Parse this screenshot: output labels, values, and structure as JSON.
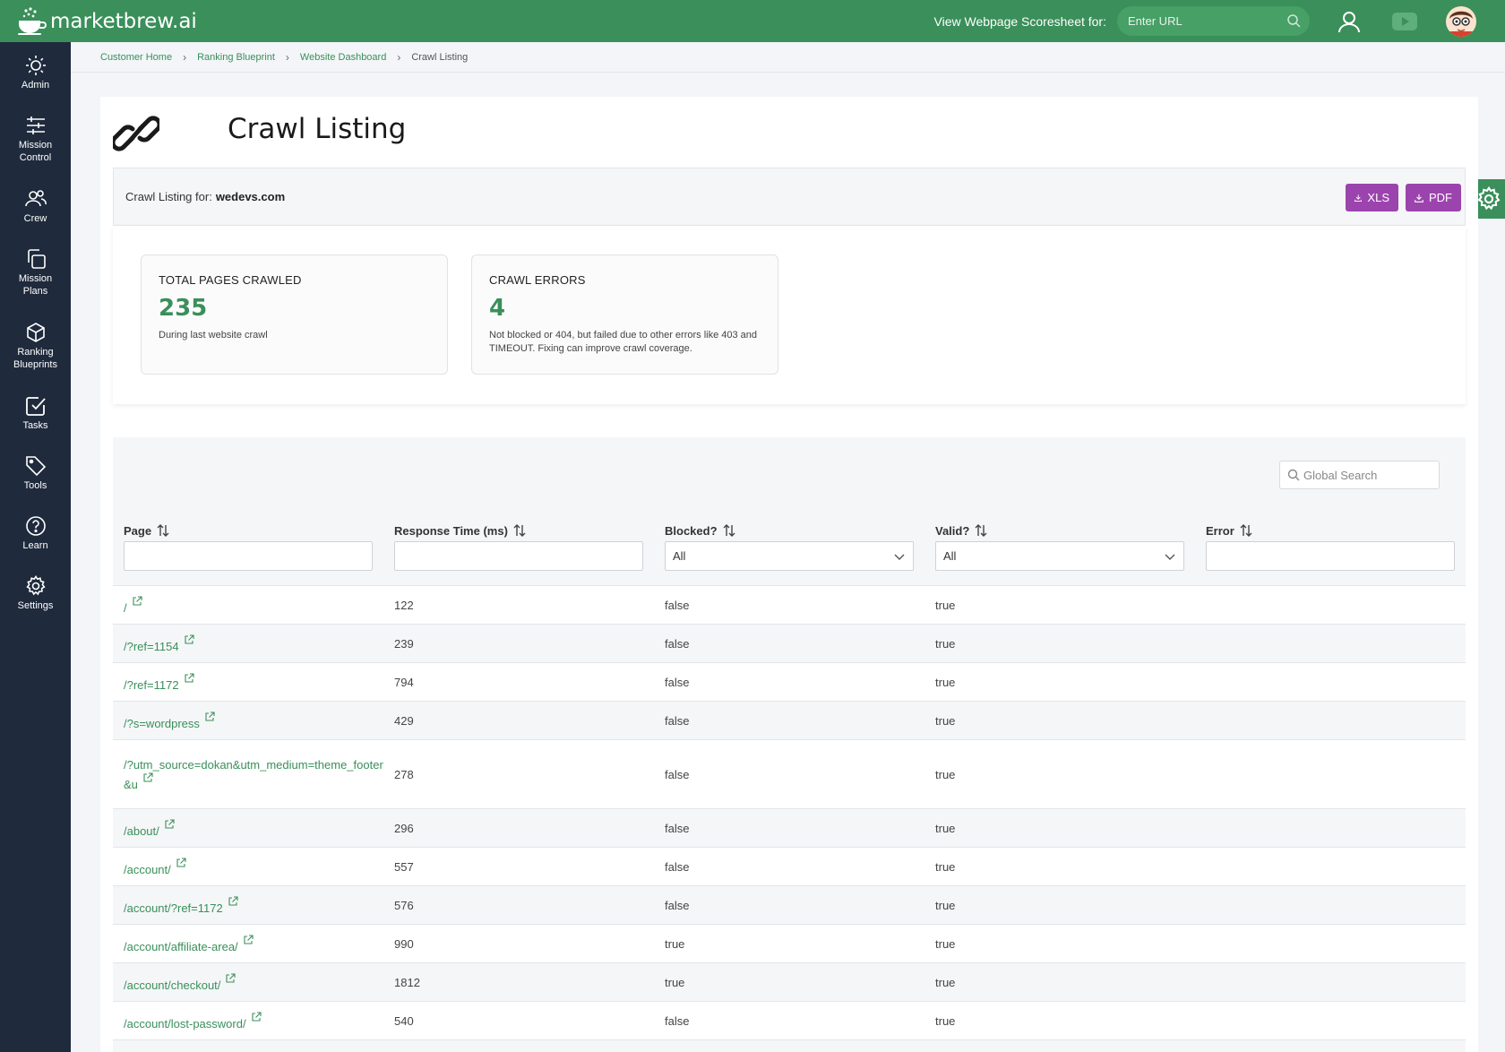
{
  "app": {
    "brand": "marketbrew.ai",
    "scoresheet_label": "View Webpage Scoresheet for:",
    "url_placeholder": "Enter URL",
    "url_value": ""
  },
  "sidebar": {
    "items": [
      {
        "label": "Admin",
        "icon": "sun-icon"
      },
      {
        "label": "Mission Control",
        "icon": "sliders-icon"
      },
      {
        "label": "Crew",
        "icon": "users-icon"
      },
      {
        "label": "Mission Plans",
        "icon": "copy-icon"
      },
      {
        "label": "Ranking Blueprints",
        "icon": "box-icon"
      },
      {
        "label": "Tasks",
        "icon": "checkbox-icon"
      },
      {
        "label": "Tools",
        "icon": "tag-icon"
      },
      {
        "label": "Learn",
        "icon": "help-circle-icon"
      },
      {
        "label": "Settings",
        "icon": "gear-icon"
      }
    ]
  },
  "breadcrumb": {
    "items": [
      "Customer Home",
      "Ranking Blueprint",
      "Website Dashboard"
    ],
    "current": "Crawl Listing"
  },
  "page": {
    "title": "Crawl Listing",
    "listing_for_label": "Crawl Listing for:",
    "domain": "wedevs.com",
    "xls_label": "XLS",
    "pdf_label": "PDF"
  },
  "stats": {
    "pages": {
      "title": "TOTAL PAGES CRAWLED",
      "value": "235",
      "desc": "During last website crawl"
    },
    "errors": {
      "title": "CRAWL ERRORS",
      "value": "4",
      "desc": "Not blocked or 404, but failed due to other errors like 403 and TIMEOUT. Fixing can improve crawl coverage."
    }
  },
  "table": {
    "global_search_placeholder": "Global Search",
    "columns": {
      "page": "Page",
      "response": "Response Time (ms)",
      "blocked": "Blocked?",
      "valid": "Valid?",
      "error": "Error"
    },
    "blocked_filter": "All",
    "valid_filter": "All",
    "rows": [
      {
        "page": "/",
        "response": "122",
        "blocked": "false",
        "valid": "true"
      },
      {
        "page": "/?ref=1154",
        "response": "239",
        "blocked": "false",
        "valid": "true"
      },
      {
        "page": "/?ref=1172",
        "response": "794",
        "blocked": "false",
        "valid": "true"
      },
      {
        "page": "/?s=wordpress",
        "response": "429",
        "blocked": "false",
        "valid": "true"
      },
      {
        "page": "/?utm_source=dokan&utm_medium=theme_footer&u",
        "response": "278",
        "blocked": "false",
        "valid": "true"
      },
      {
        "page": "/about/",
        "response": "296",
        "blocked": "false",
        "valid": "true"
      },
      {
        "page": "/account/",
        "response": "557",
        "blocked": "false",
        "valid": "true"
      },
      {
        "page": "/account/?ref=1172",
        "response": "576",
        "blocked": "false",
        "valid": "true"
      },
      {
        "page": "/account/affiliate-area/",
        "response": "990",
        "blocked": "true",
        "valid": "true"
      },
      {
        "page": "/account/checkout/",
        "response": "1812",
        "blocked": "true",
        "valid": "true"
      },
      {
        "page": "/account/lost-password/",
        "response": "540",
        "blocked": "false",
        "valid": "true"
      }
    ]
  },
  "colors": {
    "brand_green": "#3a8f5a",
    "sidebar_bg": "#1f2a3c",
    "export_purple": "#9c44ad"
  }
}
